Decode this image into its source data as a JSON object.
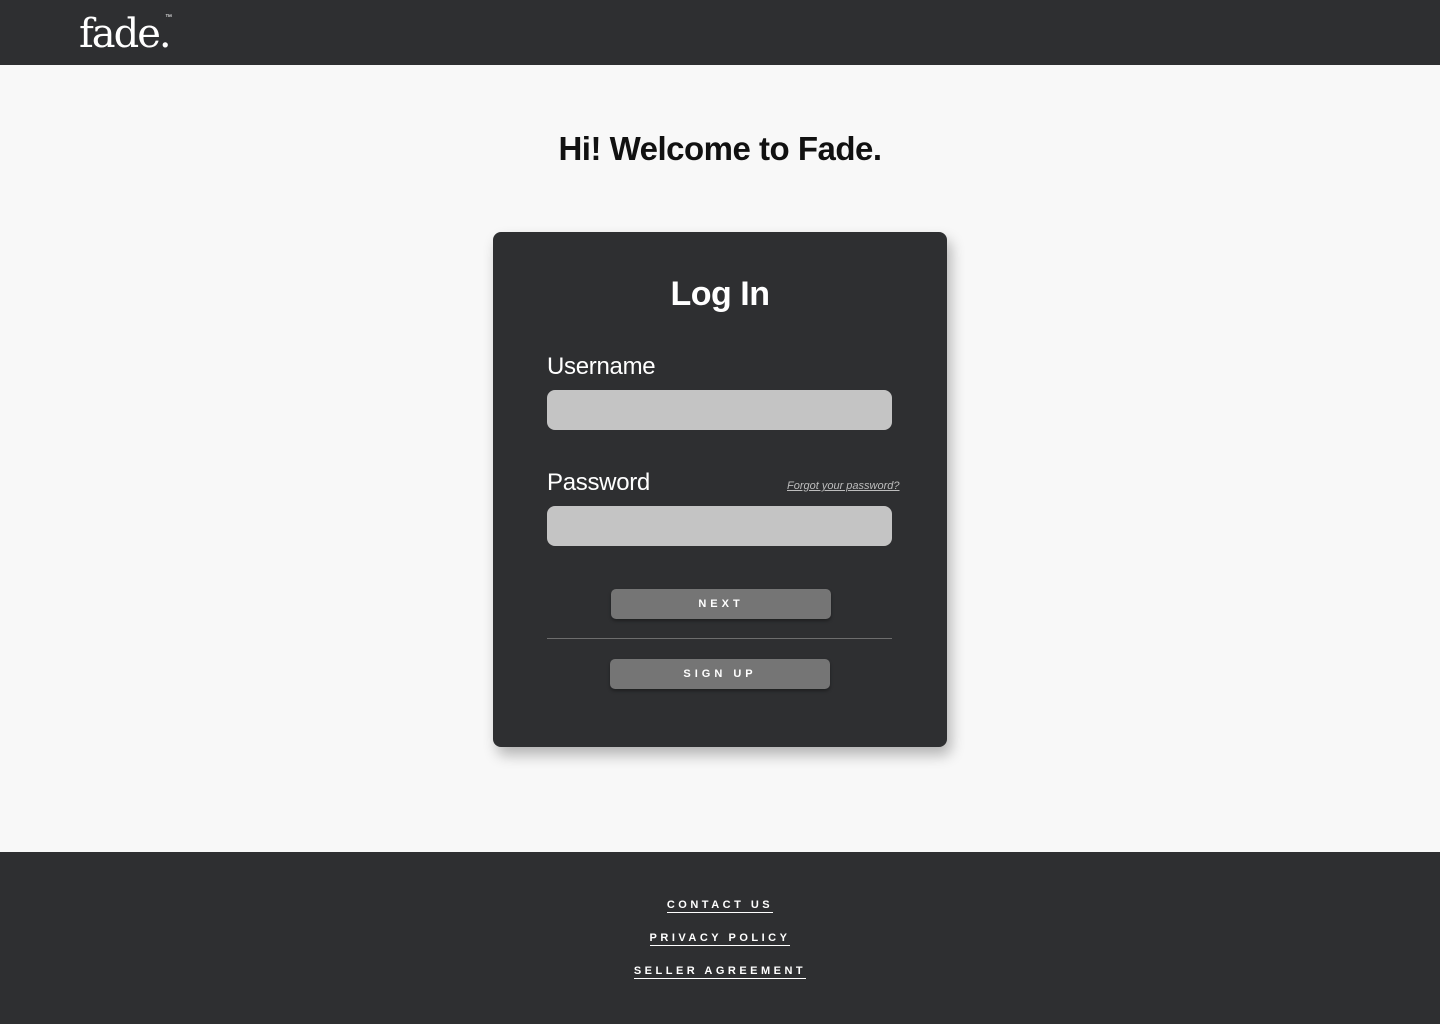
{
  "header": {
    "logo": "fade.",
    "trademark": "™"
  },
  "welcome": {
    "prefix": "Hi! Welcome to ",
    "brand": "Fade."
  },
  "login": {
    "title": "Log In",
    "username_label": "Username",
    "username_value": "",
    "password_label": "Password",
    "password_value": "",
    "forgot_link": "Forgot your password?",
    "next_button": "NEXT",
    "signup_button": "SIGN UP"
  },
  "footer": {
    "links": [
      "CONTACT US",
      "PRIVACY POLICY",
      "SELLER AGREEMENT"
    ]
  },
  "colors": {
    "dark": "#2e2f31",
    "page_bg": "#f8f8f8",
    "input_bg": "#c4c4c4",
    "button_bg": "#757575"
  }
}
